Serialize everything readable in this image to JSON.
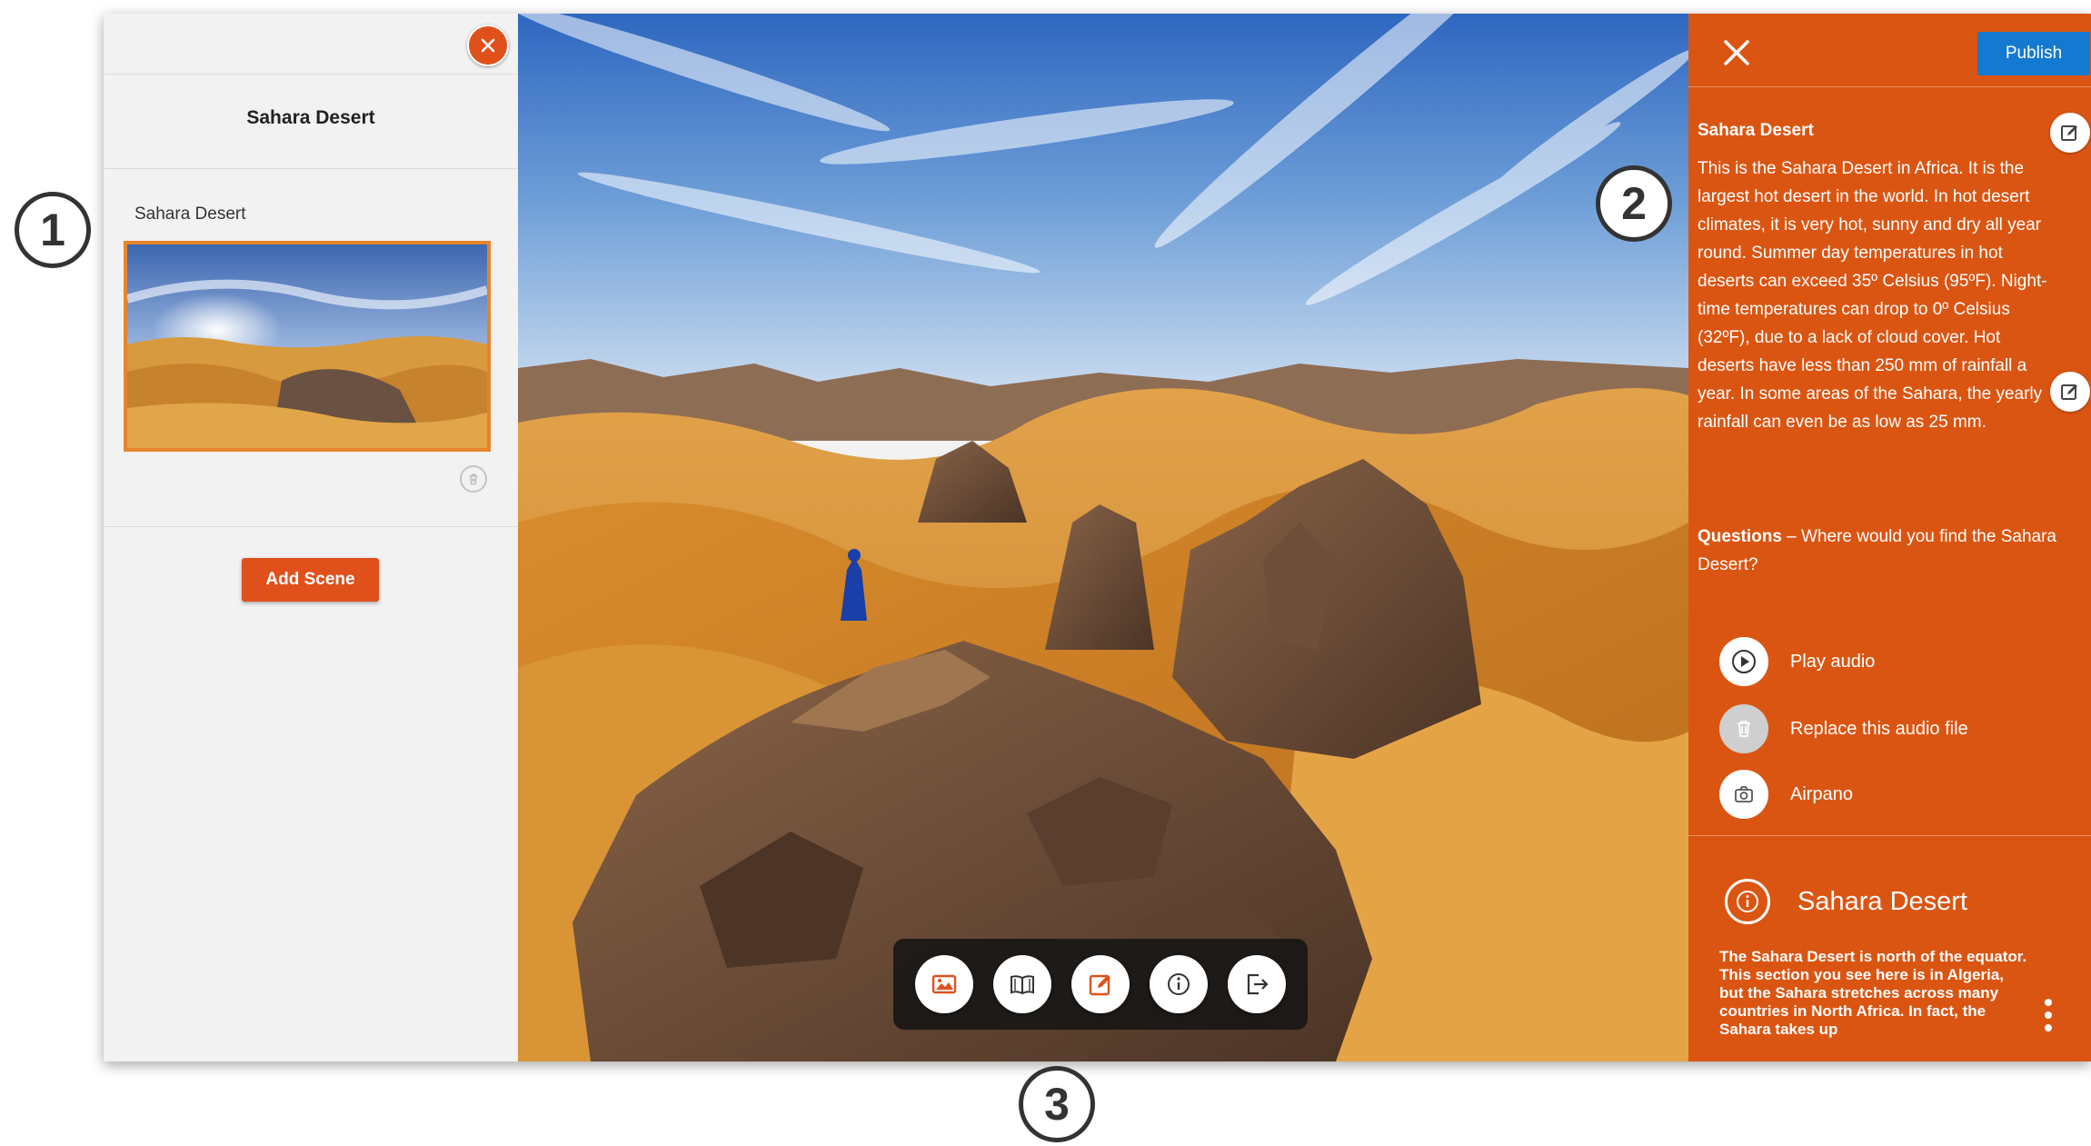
{
  "left_panel": {
    "title": "Sahara Desert",
    "scenes": [
      {
        "name": "Sahara Desert"
      }
    ],
    "add_scene_label": "Add Scene"
  },
  "toolbar": {
    "buttons": [
      {
        "icon": "image-icon"
      },
      {
        "icon": "book-icon"
      },
      {
        "icon": "edit-icon"
      },
      {
        "icon": "info-icon"
      },
      {
        "icon": "exit-icon"
      }
    ]
  },
  "right_panel": {
    "publish_label": "Publish",
    "description_title": "Sahara Desert",
    "description": "This is the Sahara Desert in Africa. It is the largest hot desert in the world. In hot desert climates, it is very hot, sunny and dry all year round. Summer day temperatures in hot deserts can exceed 35º Celsius (95ºF). Night-time temperatures can drop to 0º Celsius (32ºF), due to a lack of cloud cover. Hot deserts have less than 250 mm of rainfall a year. In some areas of the Sahara, the yearly rainfall can even be as low as 25 mm.",
    "questions_label": "Questions",
    "questions_text": " – Where would you find the Sahara Desert?",
    "audio_actions": {
      "play": "Play audio",
      "replace": "Replace this audio file",
      "credit": "Airpano"
    },
    "info_title": "Sahara Desert",
    "info_body": "The Sahara Desert is north of the equator. This section you see here is in Algeria, but the Sahara stretches across many countries in North Africa. In fact, the Sahara takes up"
  },
  "callouts": [
    "1",
    "2",
    "3"
  ],
  "colors": {
    "accent_orange": "#db5512",
    "close_orange": "#e0501b",
    "publish_blue": "#1479d1",
    "thumb_border": "#e8842a"
  }
}
